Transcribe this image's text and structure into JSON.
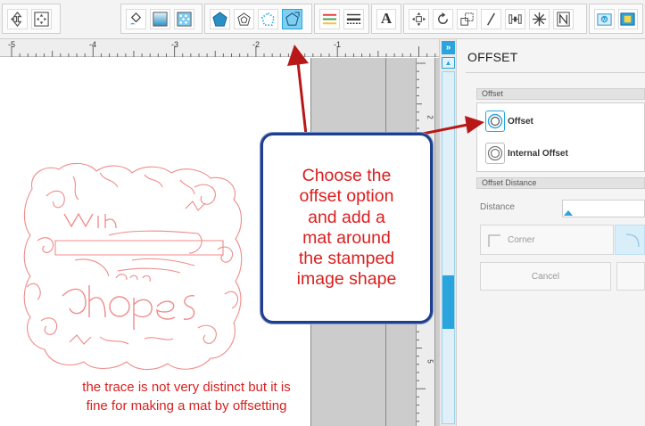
{
  "toolbar": {
    "groups": [
      {
        "name": "nav",
        "buttons": [
          "move-icon",
          "pan-icon"
        ]
      },
      {
        "name": "fill",
        "buttons": [
          "fill-bucket-icon",
          "gradient-fill-icon",
          "pattern-fill-icon"
        ]
      },
      {
        "name": "trace",
        "buttons": [
          "pentagon-icon",
          "nested-pentagon-icon",
          "dotted-pentagon-icon",
          "offset-icon"
        ],
        "active": "offset-icon"
      },
      {
        "name": "style",
        "buttons": [
          "line-color-icon",
          "line-style-icon"
        ]
      },
      {
        "name": "text",
        "buttons": [
          "text-icon"
        ]
      },
      {
        "name": "transform",
        "buttons": [
          "align-icon",
          "rotate-icon",
          "scale-icon",
          "shear-icon",
          "distribute-icon",
          "replicate-icon",
          "knife-icon"
        ]
      },
      {
        "name": "store",
        "buttons": [
          "library-icon",
          "store-icon"
        ]
      }
    ],
    "text_icon_glyph": "A"
  },
  "ruler": {
    "labels": [
      "-5",
      "-4",
      "-3",
      "-2",
      "-1"
    ],
    "vertical_labels": [
      "2",
      "3",
      "4",
      "5"
    ]
  },
  "panel": {
    "title": "OFFSET",
    "offset_section": "Offset",
    "offset_option": "Offset",
    "internal_offset_option": "Internal Offset",
    "distance_section": "Offset Distance",
    "distance_label": "Distance",
    "corner_label": "Corner",
    "cancel_label": "Cancel"
  },
  "callout": {
    "text": "Choose the\noffset option\nand add a\nmat around\nthe stamped\nimage shape"
  },
  "note": {
    "text": "the trace is not very distinct but it is\nfine for making a mat by offsetting"
  },
  "artwork": {
    "words": [
      "With",
      "flowers",
      "so comes",
      "hopes"
    ],
    "stroke_color": "#f08a8a"
  },
  "colors": {
    "accent": "#2aa4dc",
    "annotation_red": "#d92020",
    "callout_border": "#1f3f8c",
    "arrow": "#b81818"
  }
}
